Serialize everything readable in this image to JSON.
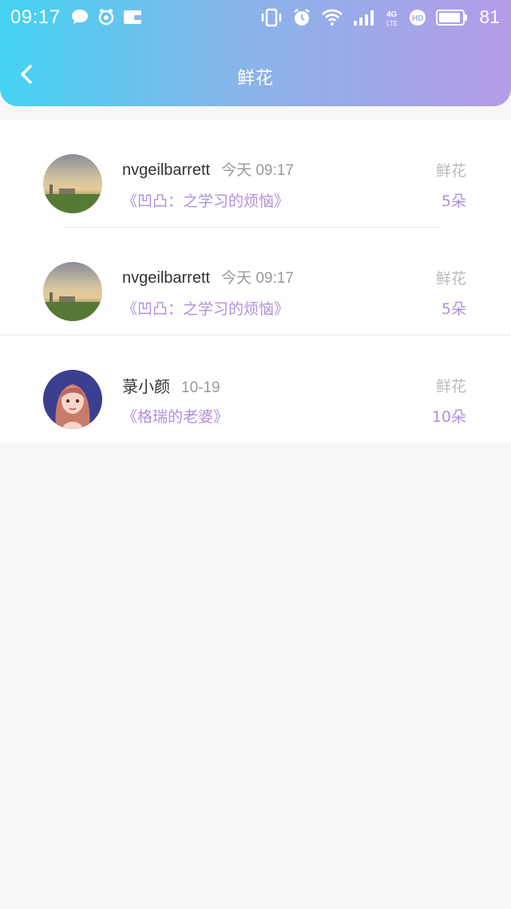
{
  "status_bar": {
    "time": "09:17",
    "battery_level": "81",
    "icons_left": [
      "chat-bubble-icon",
      "alarm-clock-icon",
      "wallet-icon"
    ],
    "icons_right": [
      "vibrate-icon",
      "alarm-icon",
      "wifi-icon",
      "signal-icon",
      "4g-lte-icon",
      "hd-icon",
      "battery-icon"
    ]
  },
  "header": {
    "title": "鲜花",
    "back_icon": "chevron-left-icon"
  },
  "colors": {
    "header_gradient": [
      "#43d3f3",
      "#86b6ea",
      "#b69be8"
    ],
    "accent_purple": "#b48ddc",
    "muted_gray": "#999999"
  },
  "records": [
    {
      "user": "nvgeilbarrett",
      "time": "今天 09:17",
      "book": "《凹凸：之学习的烦恼》",
      "label": "鲜花",
      "count": "5朵",
      "avatar": "landscape-sunset-avatar"
    },
    {
      "user": "nvgeilbarrett",
      "time": "今天 09:17",
      "book": "《凹凸：之学习的烦恼》",
      "label": "鲜花",
      "count": "5朵",
      "avatar": "landscape-sunset-avatar"
    },
    {
      "user": "菉小颜",
      "time": "10-19",
      "book": "《格瑞的老婆》",
      "label": "鲜花",
      "count": "10朵",
      "avatar": "anime-girl-avatar"
    }
  ]
}
